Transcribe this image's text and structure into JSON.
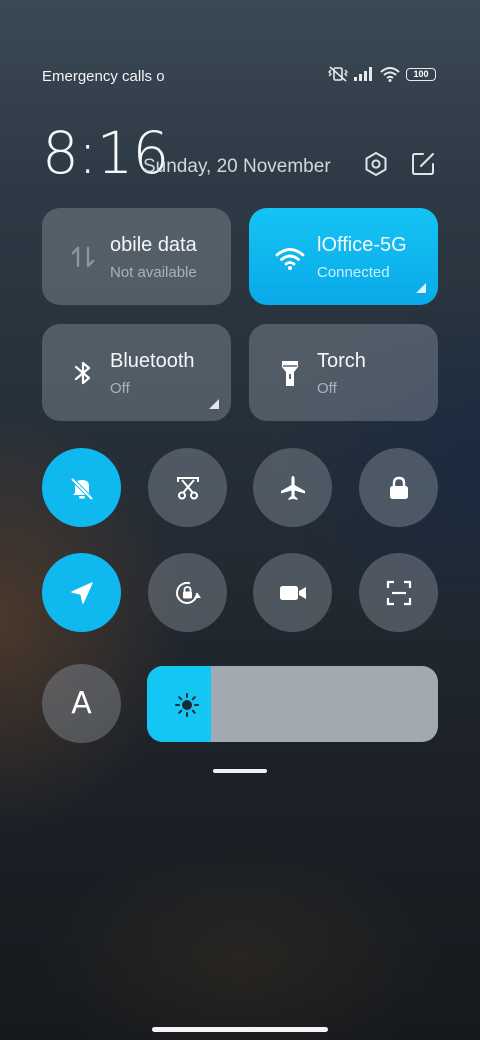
{
  "status_bar": {
    "carrier_text": "Emergency calls o",
    "battery_level": "100",
    "icons": [
      "mute-vibrate-icon",
      "signal-icon",
      "wifi-icon",
      "battery-icon"
    ]
  },
  "header": {
    "time": "8:16",
    "date": "Sunday, 20 November",
    "icons": [
      "settings-icon",
      "edit-icon"
    ]
  },
  "tiles": [
    {
      "title": "obile data",
      "subtitle": "Not available",
      "state": "off",
      "icon": "mobile-data-icon"
    },
    {
      "title": "lOffice-5G",
      "subtitle": "Connected",
      "state": "active",
      "icon": "wifi-icon"
    },
    {
      "title": "Bluetooth",
      "subtitle": "Off",
      "state": "off",
      "icon": "bluetooth-icon"
    },
    {
      "title": "Torch",
      "subtitle": "Off",
      "state": "off",
      "icon": "torch-icon"
    }
  ],
  "toggles": [
    {
      "icon": "silent-bell-icon",
      "active": true
    },
    {
      "icon": "screenshot-scissors-icon",
      "active": false
    },
    {
      "icon": "airplane-icon",
      "active": false
    },
    {
      "icon": "lock-icon",
      "active": false
    },
    {
      "icon": "location-icon",
      "active": true
    },
    {
      "icon": "rotation-lock-icon",
      "active": false
    },
    {
      "icon": "video-camera-icon",
      "active": false
    },
    {
      "icon": "scan-icon",
      "active": false
    }
  ],
  "reading_mode": {
    "label": "A"
  },
  "brightness": {
    "level_percent": 22,
    "icon": "sun-icon"
  },
  "colors": {
    "accent": "#10b8f0",
    "tile_bg": "#6b747d",
    "slider_track": "#a3a9b0"
  }
}
